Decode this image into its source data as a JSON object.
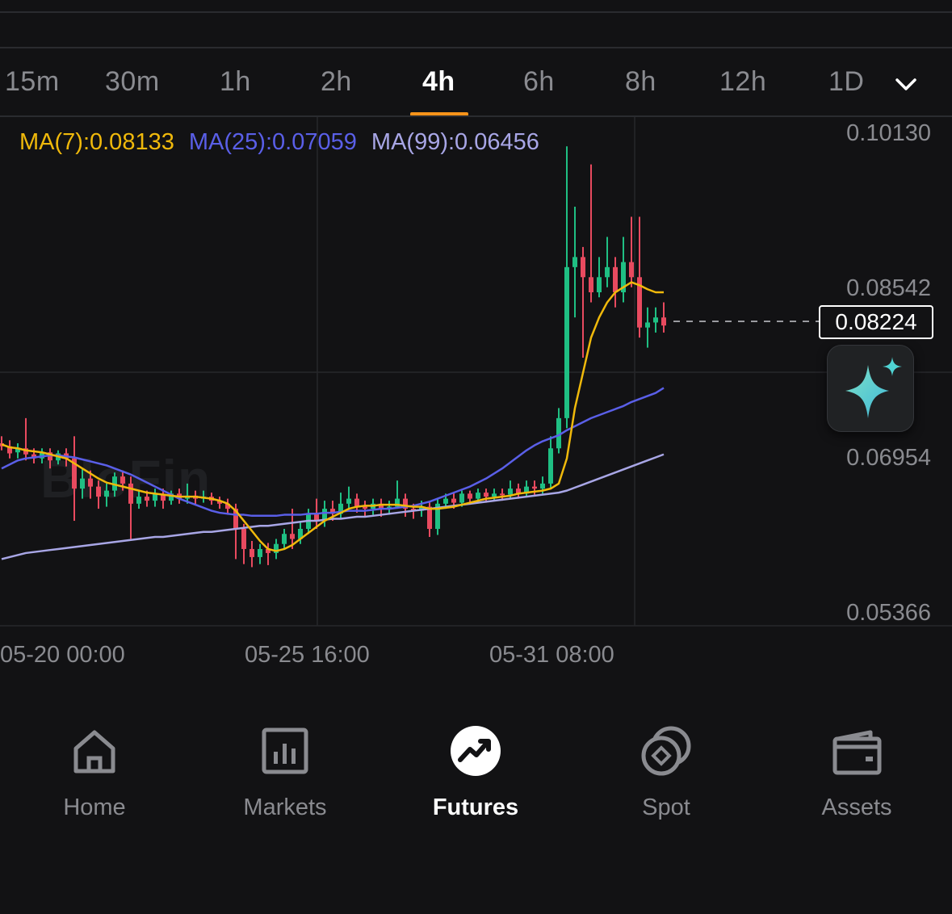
{
  "intervals": [
    "15m",
    "30m",
    "1h",
    "2h",
    "4h",
    "6h",
    "8h",
    "12h",
    "1D"
  ],
  "active_interval": "4h",
  "ma_legend": {
    "ma7": "MA(7):0.08133",
    "ma25": "MA(25):0.07059",
    "ma99": "MA(99):0.06456"
  },
  "price_axis": [
    "0.10130",
    "0.08542",
    "0.06954",
    "0.05366"
  ],
  "current_price": "0.08224",
  "time_axis": [
    "05-20 00:00",
    "05-25 16:00",
    "05-31 08:00"
  ],
  "watermark": "BloFin",
  "colors": {
    "up": "#1fbf83",
    "down": "#e84a5f",
    "ma7": "#f0b90b",
    "ma25": "#5a5fe8",
    "ma99": "#a8a6e6",
    "accent": "#f7931a"
  },
  "nav": [
    {
      "label": "Home",
      "icon": "home-icon"
    },
    {
      "label": "Markets",
      "icon": "markets-icon"
    },
    {
      "label": "Futures",
      "icon": "futures-icon"
    },
    {
      "label": "Spot",
      "icon": "spot-icon"
    },
    {
      "label": "Assets",
      "icon": "wallet-icon"
    }
  ],
  "active_nav": "Futures",
  "chart_data": {
    "type": "candlestick",
    "ylim": [
      0.05366,
      0.1013
    ],
    "current_price": 0.08224,
    "x_ticks": [
      "05-20 00:00",
      "05-25 16:00",
      "05-31 08:00"
    ],
    "candles": [
      [
        0.0705,
        0.0702,
        0.0712,
        0.0698
      ],
      [
        0.0702,
        0.0695,
        0.0708,
        0.069
      ],
      [
        0.0696,
        0.07,
        0.0705,
        0.069
      ],
      [
        0.07,
        0.0694,
        0.073,
        0.0688
      ],
      [
        0.0694,
        0.069,
        0.07,
        0.0685
      ],
      [
        0.069,
        0.0696,
        0.07,
        0.0685
      ],
      [
        0.0696,
        0.0688,
        0.07,
        0.068
      ],
      [
        0.0688,
        0.0695,
        0.0698,
        0.0684
      ],
      [
        0.0695,
        0.069,
        0.07,
        0.0682
      ],
      [
        0.069,
        0.066,
        0.0712,
        0.0628
      ],
      [
        0.066,
        0.067,
        0.068,
        0.065
      ],
      [
        0.067,
        0.0662,
        0.0678,
        0.065
      ],
      [
        0.0662,
        0.0652,
        0.0668,
        0.064
      ],
      [
        0.0652,
        0.0658,
        0.0665,
        0.0642
      ],
      [
        0.0658,
        0.0672,
        0.0676,
        0.0652
      ],
      [
        0.0672,
        0.0665,
        0.0678,
        0.0658
      ],
      [
        0.0665,
        0.0645,
        0.0672,
        0.061
      ],
      [
        0.0645,
        0.0652,
        0.0658,
        0.064
      ],
      [
        0.0652,
        0.0648,
        0.0658,
        0.0642
      ],
      [
        0.0648,
        0.0655,
        0.066,
        0.0642
      ],
      [
        0.0655,
        0.0648,
        0.066,
        0.064
      ],
      [
        0.0648,
        0.0655,
        0.0658,
        0.0644
      ],
      [
        0.0655,
        0.065,
        0.066,
        0.0645
      ],
      [
        0.065,
        0.0653,
        0.0665,
        0.0645
      ],
      [
        0.0653,
        0.065,
        0.0658,
        0.0644
      ],
      [
        0.065,
        0.0652,
        0.0658,
        0.0646
      ],
      [
        0.0652,
        0.0648,
        0.0656,
        0.0644
      ],
      [
        0.0648,
        0.0645,
        0.0652,
        0.064
      ],
      [
        0.0645,
        0.064,
        0.065,
        0.0634
      ],
      [
        0.064,
        0.062,
        0.0645,
        0.059
      ],
      [
        0.062,
        0.06,
        0.0625,
        0.0585
      ],
      [
        0.06,
        0.0592,
        0.0608,
        0.0582
      ],
      [
        0.0592,
        0.06,
        0.0605,
        0.0585
      ],
      [
        0.06,
        0.0596,
        0.0606,
        0.0584
      ],
      [
        0.0596,
        0.0605,
        0.061,
        0.059
      ],
      [
        0.0605,
        0.0615,
        0.062,
        0.06
      ],
      [
        0.0615,
        0.061,
        0.064,
        0.06
      ],
      [
        0.061,
        0.062,
        0.0628,
        0.0605
      ],
      [
        0.062,
        0.0635,
        0.064,
        0.0615
      ],
      [
        0.0635,
        0.0628,
        0.065,
        0.062
      ],
      [
        0.0628,
        0.064,
        0.0648,
        0.0622
      ],
      [
        0.064,
        0.0635,
        0.0648,
        0.0628
      ],
      [
        0.0635,
        0.0645,
        0.0656,
        0.063
      ],
      [
        0.0645,
        0.065,
        0.0662,
        0.064
      ],
      [
        0.065,
        0.0642,
        0.0655,
        0.0636
      ],
      [
        0.0642,
        0.064,
        0.0648,
        0.0632
      ],
      [
        0.064,
        0.0645,
        0.065,
        0.0634
      ],
      [
        0.0645,
        0.064,
        0.065,
        0.0632
      ],
      [
        0.064,
        0.0642,
        0.0648,
        0.0634
      ],
      [
        0.0642,
        0.065,
        0.0668,
        0.064
      ],
      [
        0.065,
        0.064,
        0.0655,
        0.0632
      ],
      [
        0.064,
        0.0638,
        0.0645,
        0.063
      ],
      [
        0.0638,
        0.0642,
        0.0648,
        0.0632
      ],
      [
        0.0642,
        0.062,
        0.0648,
        0.0612
      ],
      [
        0.062,
        0.0645,
        0.065,
        0.0614
      ],
      [
        0.0645,
        0.065,
        0.0655,
        0.064
      ],
      [
        0.065,
        0.0646,
        0.0656,
        0.064
      ],
      [
        0.0646,
        0.0655,
        0.0658,
        0.0642
      ],
      [
        0.0655,
        0.065,
        0.0658,
        0.0644
      ],
      [
        0.065,
        0.0656,
        0.066,
        0.0646
      ],
      [
        0.0656,
        0.0652,
        0.066,
        0.0646
      ],
      [
        0.0652,
        0.0655,
        0.066,
        0.0648
      ],
      [
        0.0655,
        0.0654,
        0.066,
        0.0648
      ],
      [
        0.0654,
        0.066,
        0.0668,
        0.065
      ],
      [
        0.066,
        0.0655,
        0.0665,
        0.065
      ],
      [
        0.0655,
        0.0662,
        0.0668,
        0.0652
      ],
      [
        0.0662,
        0.066,
        0.0668,
        0.0654
      ],
      [
        0.066,
        0.0665,
        0.0672,
        0.0655
      ],
      [
        0.0665,
        0.07,
        0.0712,
        0.066
      ],
      [
        0.07,
        0.073,
        0.074,
        0.0695
      ],
      [
        0.073,
        0.088,
        0.1,
        0.072
      ],
      [
        0.088,
        0.089,
        0.094,
        0.083
      ],
      [
        0.089,
        0.087,
        0.09,
        0.079
      ],
      [
        0.087,
        0.0855,
        0.0982,
        0.0845
      ],
      [
        0.0855,
        0.087,
        0.089,
        0.085
      ],
      [
        0.087,
        0.088,
        0.091,
        0.086
      ],
      [
        0.088,
        0.0855,
        0.089,
        0.084
      ],
      [
        0.0855,
        0.0885,
        0.091,
        0.0845
      ],
      [
        0.0885,
        0.087,
        0.093,
        0.086
      ],
      [
        0.087,
        0.082,
        0.093,
        0.081
      ],
      [
        0.082,
        0.0825,
        0.084,
        0.08
      ],
      [
        0.0825,
        0.083,
        0.084,
        0.0815
      ],
      [
        0.083,
        0.0822,
        0.0845,
        0.0815
      ]
    ],
    "ma7": [
      0.0704,
      0.0701,
      0.07,
      0.0698,
      0.0697,
      0.0696,
      0.0694,
      0.0692,
      0.069,
      0.0685,
      0.068,
      0.0675,
      0.067,
      0.0666,
      0.0664,
      0.0662,
      0.066,
      0.0658,
      0.0656,
      0.0655,
      0.0654,
      0.0653,
      0.0652,
      0.0652,
      0.0652,
      0.0651,
      0.065,
      0.0648,
      0.0645,
      0.0638,
      0.0628,
      0.0618,
      0.0608,
      0.06,
      0.0598,
      0.06,
      0.0604,
      0.061,
      0.0616,
      0.0622,
      0.0628,
      0.0632,
      0.0636,
      0.064,
      0.0642,
      0.0643,
      0.0643,
      0.0644,
      0.0644,
      0.0644,
      0.0643,
      0.0642,
      0.0642,
      0.064,
      0.064,
      0.0641,
      0.0642,
      0.0644,
      0.0646,
      0.0648,
      0.065,
      0.0651,
      0.0652,
      0.0653,
      0.0655,
      0.0656,
      0.0657,
      0.0658,
      0.066,
      0.0665,
      0.069,
      0.074,
      0.0775,
      0.081,
      0.083,
      0.0845,
      0.0855,
      0.086,
      0.0865,
      0.0862,
      0.0858,
      0.0855,
      0.0855
    ],
    "ma25": [
      0.068,
      0.0684,
      0.0688,
      0.069,
      0.0691,
      0.0692,
      0.0693,
      0.0693,
      0.0692,
      0.0691,
      0.0689,
      0.0687,
      0.0685,
      0.0683,
      0.068,
      0.0677,
      0.0674,
      0.067,
      0.0666,
      0.0662,
      0.0658,
      0.0654,
      0.065,
      0.0647,
      0.0644,
      0.0641,
      0.0638,
      0.0636,
      0.0635,
      0.0634,
      0.0634,
      0.0633,
      0.0633,
      0.0633,
      0.0633,
      0.0634,
      0.0634,
      0.0634,
      0.0635,
      0.0635,
      0.0636,
      0.0636,
      0.0637,
      0.0638,
      0.0638,
      0.0638,
      0.0639,
      0.064,
      0.064,
      0.0641,
      0.0642,
      0.0643,
      0.0645,
      0.0647,
      0.065,
      0.0653,
      0.0656,
      0.0659,
      0.0662,
      0.0666,
      0.067,
      0.0675,
      0.068,
      0.0686,
      0.0692,
      0.0698,
      0.0703,
      0.0707,
      0.071,
      0.0713,
      0.0718,
      0.0722,
      0.0726,
      0.073,
      0.0733,
      0.0736,
      0.0739,
      0.0742,
      0.0746,
      0.0749,
      0.0752,
      0.0755,
      0.076
    ],
    "ma99": [
      0.059,
      0.0592,
      0.0594,
      0.0596,
      0.0597,
      0.0598,
      0.0599,
      0.06,
      0.0601,
      0.0602,
      0.0603,
      0.0604,
      0.0605,
      0.0606,
      0.0607,
      0.0608,
      0.0609,
      0.061,
      0.0611,
      0.0612,
      0.0612,
      0.0613,
      0.0614,
      0.0615,
      0.0616,
      0.0617,
      0.0617,
      0.0618,
      0.0619,
      0.062,
      0.0621,
      0.0622,
      0.0623,
      0.0623,
      0.0624,
      0.0625,
      0.0626,
      0.0627,
      0.0628,
      0.0628,
      0.0629,
      0.063,
      0.063,
      0.0631,
      0.0632,
      0.0632,
      0.0633,
      0.0634,
      0.0635,
      0.0636,
      0.0637,
      0.0638,
      0.0639,
      0.064,
      0.0641,
      0.0642,
      0.0643,
      0.0644,
      0.0645,
      0.0646,
      0.0647,
      0.0648,
      0.0649,
      0.065,
      0.0651,
      0.0652,
      0.0653,
      0.0654,
      0.0655,
      0.0656,
      0.0658,
      0.0661,
      0.0664,
      0.0667,
      0.067,
      0.0673,
      0.0676,
      0.0679,
      0.0682,
      0.0685,
      0.0688,
      0.0691,
      0.0694
    ]
  }
}
